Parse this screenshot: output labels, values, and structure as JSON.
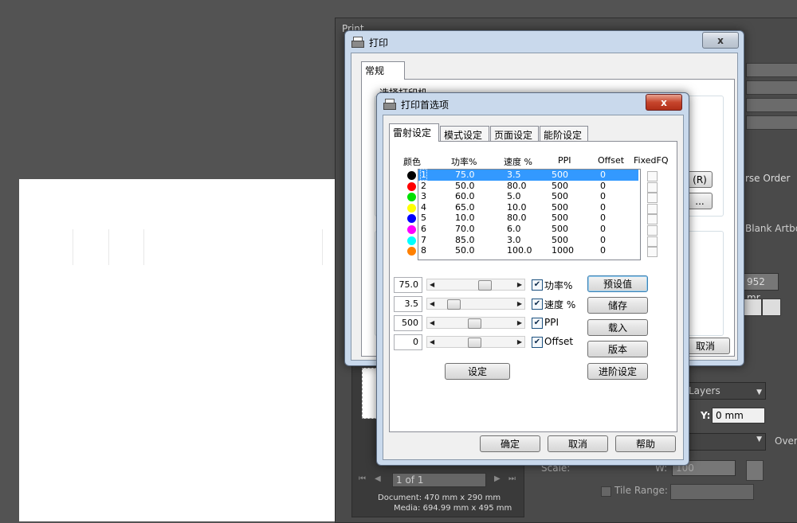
{
  "ai_dialog": {
    "title": "Print",
    "reverse_order": "rse Order",
    "blank_artboards": "Blank Artboa",
    "size_value": "952 mr",
    "layers": "Layers",
    "y_label": "Y:",
    "y_value": "0 mm",
    "overflow": "Overf",
    "scale": "Scale:",
    "w_label": "W:",
    "w_value": "100",
    "tile_range": "Tile Range:",
    "page_nav": "1 of 1",
    "document_info": "Document: 470 mm x 290 mm",
    "media_info": "Media: 694.99 mm x 495 mm",
    "side_buttons": [
      "(R)",
      "..."
    ]
  },
  "print_dialog": {
    "title": "打印",
    "close": "x",
    "tab": "常规",
    "select_printer": "选择打印机",
    "cancel": "取消"
  },
  "prefs_dialog": {
    "title": "打印首选项",
    "close": "x",
    "tabs": [
      "雷射设定",
      "模式设定",
      "页面设定",
      "能阶设定"
    ],
    "columns": [
      "颜色",
      "功率%",
      "速度 %",
      "PPI",
      "Offset",
      "FixedFQ"
    ],
    "rows": [
      {
        "idx": "1",
        "color": "#000000",
        "power": "75.0",
        "speed": "3.5",
        "ppi": "500",
        "offset": "0"
      },
      {
        "idx": "2",
        "color": "#ff0000",
        "power": "50.0",
        "speed": "80.0",
        "ppi": "500",
        "offset": "0"
      },
      {
        "idx": "3",
        "color": "#00e000",
        "power": "60.0",
        "speed": "5.0",
        "ppi": "500",
        "offset": "0"
      },
      {
        "idx": "4",
        "color": "#ffff00",
        "power": "65.0",
        "speed": "10.0",
        "ppi": "500",
        "offset": "0"
      },
      {
        "idx": "5",
        "color": "#0000ff",
        "power": "10.0",
        "speed": "80.0",
        "ppi": "500",
        "offset": "0"
      },
      {
        "idx": "6",
        "color": "#ff00ff",
        "power": "70.0",
        "speed": "6.0",
        "ppi": "500",
        "offset": "0"
      },
      {
        "idx": "7",
        "color": "#00ffff",
        "power": "85.0",
        "speed": "3.0",
        "ppi": "500",
        "offset": "0"
      },
      {
        "idx": "8",
        "color": "#ff8000",
        "power": "50.0",
        "speed": "100.0",
        "ppi": "1000",
        "offset": "0"
      }
    ],
    "selected_row": 0,
    "controls": [
      {
        "value": "75.0",
        "label": "功率%",
        "checked": true,
        "level": 0.62
      },
      {
        "value": "3.5",
        "label": "速度 %",
        "checked": true,
        "level": 0.15
      },
      {
        "value": "500",
        "label": "PPI",
        "checked": true,
        "level": 0.47
      },
      {
        "value": "0",
        "label": "Offset",
        "checked": true,
        "level": 0.47
      }
    ],
    "right_buttons": [
      "预设值",
      "储存",
      "载入",
      "版本",
      "进阶设定"
    ],
    "set_button": "设定",
    "ok": "确定",
    "cancel": "取消",
    "help": "帮助"
  }
}
